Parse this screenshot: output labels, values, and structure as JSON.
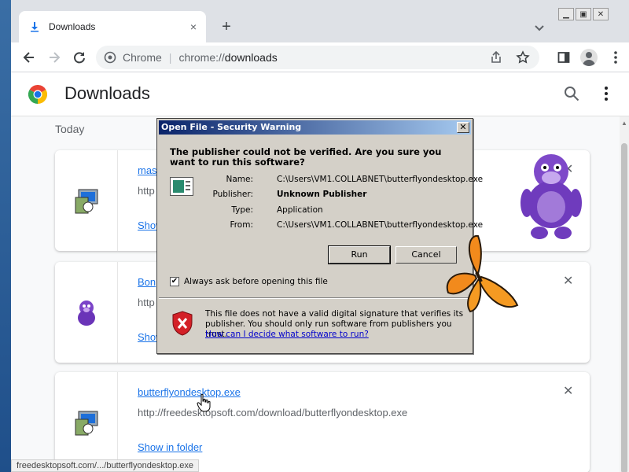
{
  "browser": {
    "tab": {
      "title": "Downloads",
      "close": "×"
    },
    "new_tab": "+",
    "omnibox": {
      "site_label": "Chrome",
      "scheme": "chrome://",
      "host": "downloads"
    }
  },
  "page": {
    "title": "Downloads",
    "section": "Today"
  },
  "downloads": [
    {
      "name": "mas",
      "url": "http",
      "action": "Show"
    },
    {
      "name": "Bon",
      "url": "http",
      "action": "Show"
    },
    {
      "name": "butterflyondesktop.exe",
      "url": "http://freedesktopsoft.com/download/butterflyondesktop.exe",
      "action": "Show in folder"
    }
  ],
  "status_bar": "freedesktopsoft.com/.../butterflyondesktop.exe",
  "dialog": {
    "title": "Open File - Security Warning",
    "close": "✕",
    "question": "The publisher could not be verified.  Are you sure you want to run this software?",
    "fields": [
      {
        "label": "Name:",
        "value": "C:\\Users\\VM1.COLLABNET\\butterflyondesktop.exe"
      },
      {
        "label": "Publisher:",
        "value": "Unknown Publisher"
      },
      {
        "label": "Type:",
        "value": "Application"
      },
      {
        "label": "From:",
        "value": "C:\\Users\\VM1.COLLABNET\\butterflyondesktop.exe"
      }
    ],
    "run_label": "Run",
    "cancel_label": "Cancel",
    "checkbox_label": "Always ask before opening this file",
    "checkbox_checked": true,
    "warning": "This file does not have a valid digital signature that verifies its publisher.  You should only run software from publishers you trust.",
    "help_link": "How can I decide what software to run?"
  },
  "colors": {
    "link": "#1a73e8",
    "dialog_bg": "#d4d0c8",
    "titlebar": "#0a246a"
  }
}
